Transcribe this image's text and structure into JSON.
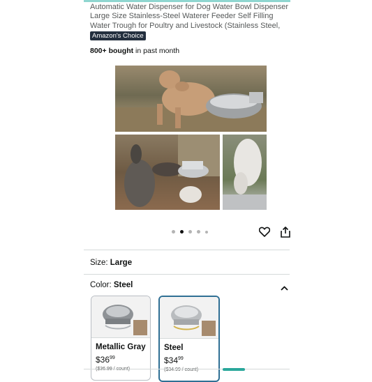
{
  "product": {
    "title": "Automatic Water Dispenser for Dog Water Bowl Dispenser Large Size Stainless-Steel Waterer Feeder Self Filling Water Trough for Poultry and Livestock (Stainless Steel, Large)",
    "badge": "Amazon's Choice",
    "bought_count": "800+ bought",
    "bought_suffix": " in past month"
  },
  "gallery": {
    "dot_count": 5,
    "active_dot_index": 1
  },
  "size": {
    "label": "Size:",
    "value": "Large"
  },
  "color": {
    "label": "Color:",
    "value": "Steel",
    "options": [
      {
        "name": "Metallic Gray",
        "price_dollars": "$36",
        "price_cents": "99",
        "unit_price": "($36.99 / count)",
        "selected": false
      },
      {
        "name": "Steel",
        "price_dollars": "$34",
        "price_cents": "99",
        "unit_price": "($34.99 / count)",
        "selected": true
      }
    ]
  },
  "icons": {
    "wishlist": "heart-icon",
    "share": "share-icon",
    "collapse": "chevron-up-icon"
  },
  "colors": {
    "badge_bg": "#232f3e",
    "selected_border": "#2f6f94",
    "accent": "#2aa79b"
  }
}
